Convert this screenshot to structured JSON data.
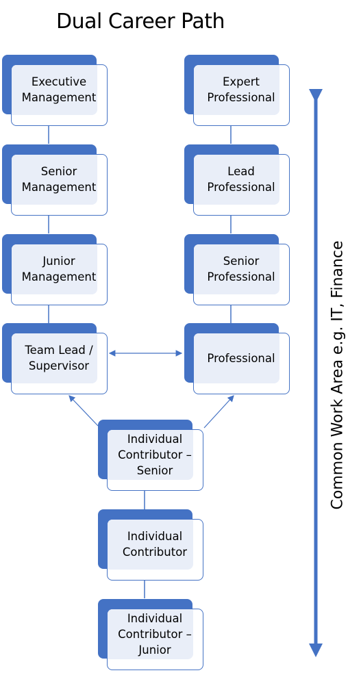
{
  "title": "Dual Career Path",
  "side_axis_label": "Common Work Area e.g. IT, Finance",
  "colors": {
    "accent": "#4472c4",
    "tint": "#e9eef8"
  },
  "management_track": [
    {
      "label": "Executive Management"
    },
    {
      "label": "Senior Management"
    },
    {
      "label": "Junior Management"
    },
    {
      "label": "Team Lead / Supervisor"
    }
  ],
  "professional_track": [
    {
      "label": "Expert Professional"
    },
    {
      "label": "Lead Professional"
    },
    {
      "label": "Senior Professional"
    },
    {
      "label": "Professional"
    }
  ],
  "contributor_track": [
    {
      "label": "Individual Contributor – Senior"
    },
    {
      "label": "Individual Contributor"
    },
    {
      "label": "Individual Contributor – Junior"
    }
  ]
}
